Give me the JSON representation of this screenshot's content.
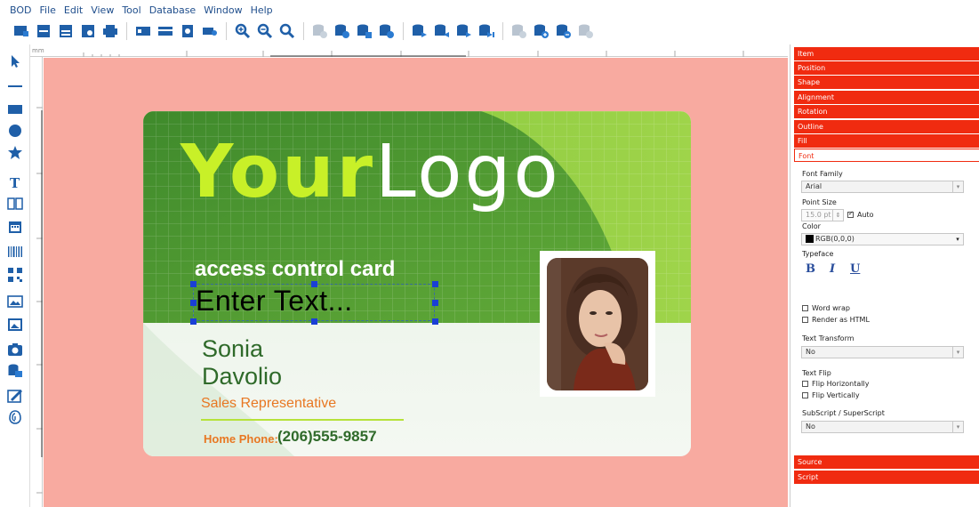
{
  "menu": [
    "BOD",
    "File",
    "Edit",
    "View",
    "Tool",
    "Database",
    "Window",
    "Help"
  ],
  "toolbar_icons": [
    "new-icon",
    "open-icon",
    "save-icon",
    "save-as-icon",
    "print-icon",
    "card-front-icon",
    "card-back-icon",
    "card-settings-icon",
    "card-properties-icon",
    "zoom-in-icon",
    "zoom-out-icon",
    "zoom-fit-icon",
    "db-icon",
    "db-connect-icon",
    "db-query-icon",
    "db-refresh-icon",
    "db-first-icon",
    "db-prev-icon",
    "db-next-icon",
    "db-last-icon",
    "db-filter-icon",
    "db-add-icon",
    "db-remove-icon",
    "db-save-icon"
  ],
  "tools": [
    "pointer-icon",
    "line-icon",
    "rectangle-icon",
    "ellipse-icon",
    "star-icon",
    "text-icon",
    "counter-icon",
    "date-icon",
    "barcode-icon",
    "qrcode-icon",
    "image-icon",
    "picture-icon",
    "camera-icon",
    "database-image-icon",
    "signature-icon",
    "fingerprint-icon"
  ],
  "ruler": {
    "unit": "mm"
  },
  "card": {
    "logo_part1": "Your",
    "logo_part2": "Logo",
    "title": "access control card",
    "selected_text": "Enter Text...",
    "first_name": "Sonia",
    "last_name": "Davolio",
    "role": "Sales Representative",
    "phone_label": "Home Phone:",
    "phone_value": "(206)555-9857",
    "colors": {
      "green_dark": "#3e8a2a",
      "green_light": "#7ec73a",
      "logo_accent": "#c8f028",
      "canvas": "#f8aaa0",
      "orange": "#e87722"
    }
  },
  "panel": {
    "sections_top": [
      "Item",
      "Position",
      "Shape",
      "Alignment",
      "Rotation",
      "Outline",
      "Fill"
    ],
    "font_section": "Font",
    "font_family_label": "Font Family",
    "font_family_value": "Arial",
    "point_size_label": "Point Size",
    "point_size_value": "15.0 pt",
    "auto_label": "Auto",
    "auto_checked": true,
    "color_label": "Color",
    "color_value": "RGB(0,0,0)",
    "typeface_label": "Typeface",
    "bold": "B",
    "italic": "I",
    "underline": "U",
    "word_wrap": "Word wrap",
    "render_html": "Render as HTML",
    "text_transform_label": "Text Transform",
    "text_transform_value": "No",
    "text_flip_label": "Text Flip",
    "flip_h": "Flip Horizontally",
    "flip_v": "Flip Vertically",
    "subsup_label": "SubScript / SuperScript",
    "subsup_value": "No",
    "sections_bottom": [
      "Source",
      "Script"
    ],
    "accent": "#f02b10"
  }
}
